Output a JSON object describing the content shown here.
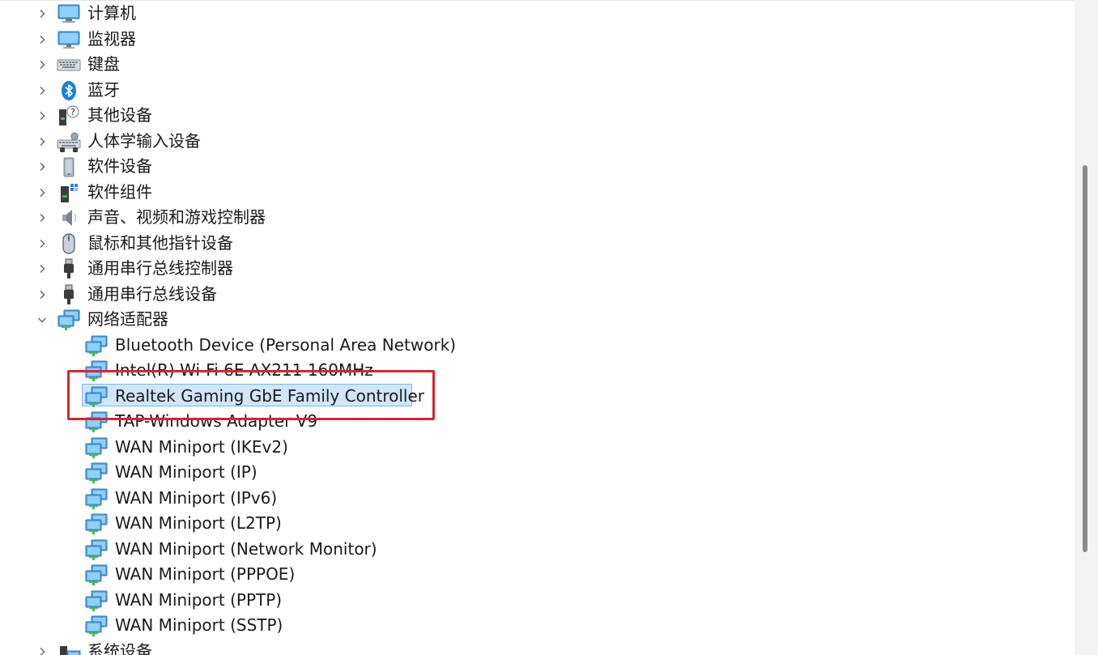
{
  "device_tree": {
    "categories": [
      {
        "label": "计算机",
        "icon": "computer-icon",
        "expanded": false
      },
      {
        "label": "监视器",
        "icon": "monitor-icon",
        "expanded": false
      },
      {
        "label": "键盘",
        "icon": "keyboard-icon",
        "expanded": false
      },
      {
        "label": "蓝牙",
        "icon": "bluetooth-icon",
        "expanded": false
      },
      {
        "label": "其他设备",
        "icon": "unknown-device-icon",
        "expanded": false
      },
      {
        "label": "人体学输入设备",
        "icon": "hid-icon",
        "expanded": false
      },
      {
        "label": "软件设备",
        "icon": "software-device-icon",
        "expanded": false
      },
      {
        "label": "软件组件",
        "icon": "software-component-icon",
        "expanded": false
      },
      {
        "label": "声音、视频和游戏控制器",
        "icon": "speaker-icon",
        "expanded": false
      },
      {
        "label": "鼠标和其他指针设备",
        "icon": "mouse-icon",
        "expanded": false
      },
      {
        "label": "通用串行总线控制器",
        "icon": "usb-icon",
        "expanded": false
      },
      {
        "label": "通用串行总线设备",
        "icon": "usb-icon",
        "expanded": false
      },
      {
        "label": "网络适配器",
        "icon": "network-adapter-icon",
        "expanded": true
      },
      {
        "label": "系统设备",
        "icon": "system-device-icon",
        "expanded": false
      }
    ],
    "network_adapters": [
      {
        "label": "Bluetooth Device (Personal Area Network)"
      },
      {
        "label": "Intel(R) Wi-Fi 6E AX211 160MHz"
      },
      {
        "label": "Realtek Gaming GbE Family Controller",
        "selected": true
      },
      {
        "label": "TAP-Windows Adapter V9"
      },
      {
        "label": "WAN Miniport (IKEv2)"
      },
      {
        "label": "WAN Miniport (IP)"
      },
      {
        "label": "WAN Miniport (IPv6)"
      },
      {
        "label": "WAN Miniport (L2TP)"
      },
      {
        "label": "WAN Miniport (Network Monitor)"
      },
      {
        "label": "WAN Miniport (PPPOE)"
      },
      {
        "label": "WAN Miniport (PPTP)"
      },
      {
        "label": "WAN Miniport (SSTP)"
      }
    ]
  },
  "colors": {
    "selection_bg": "#cfe6fb",
    "selection_border": "#7fb6e8",
    "annotation_border": "#d9252f",
    "scrollbar_thumb": "#8b8b8b"
  }
}
